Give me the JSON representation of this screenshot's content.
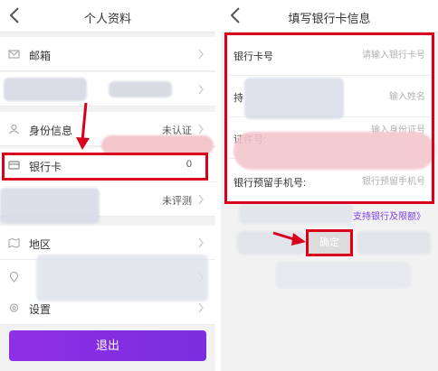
{
  "left": {
    "title": "个人资料",
    "rows": [
      {
        "label": "邮箱",
        "value": ""
      },
      {
        "label": "",
        "value": ""
      },
      {
        "label": "身份信息",
        "value": "未认证"
      },
      {
        "label": "银行卡",
        "value": "0"
      },
      {
        "label": "",
        "value": "未评测"
      },
      {
        "label": "地区",
        "value": ""
      },
      {
        "label": "",
        "value": ""
      },
      {
        "label": "设置",
        "value": ""
      }
    ],
    "logout_label": "退出"
  },
  "right": {
    "title": "填写银行卡信息",
    "fields": [
      {
        "label": "银行卡号",
        "placeholder": "请输入银行卡号"
      },
      {
        "label": "持",
        "placeholder": "输入姓名"
      },
      {
        "label": "证件号:",
        "placeholder": "输入身份证号"
      },
      {
        "label": "银行预留手机号:",
        "placeholder": "银行预留手机号"
      }
    ],
    "support_link": "支持银行及限额》",
    "confirm_label": "确定"
  },
  "colors": {
    "annotation_red": "#d9001b",
    "accent_purple": "#8a2be2",
    "link_purple": "#7b3fe4"
  },
  "icons": [
    "back-icon",
    "chevron-right-icon",
    "mail-icon",
    "id-card-icon",
    "bank-card-icon",
    "map-icon",
    "location-icon",
    "settings-icon"
  ]
}
